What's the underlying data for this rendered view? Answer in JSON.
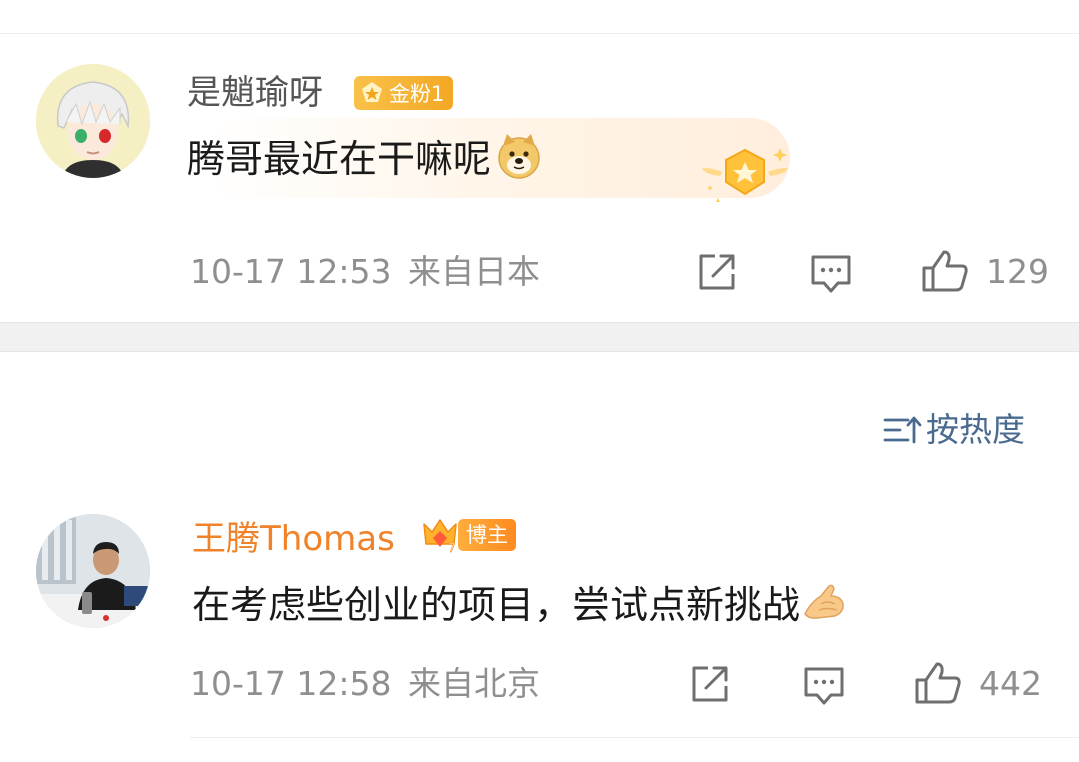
{
  "comments": [
    {
      "username": "是魈瑜呀",
      "badge": "金粉1",
      "text": "腾哥最近在干嘛呢",
      "timestamp": "10-17 12:53",
      "location": "来自日本",
      "likes": "129",
      "username_color": "#555555"
    },
    {
      "username": "王腾Thomas",
      "badge": "博主",
      "text": "在考虑些创业的项目，尝试点新挑战",
      "timestamp": "10-17 12:58",
      "location": "来自北京",
      "likes": "442",
      "username_color": "#f0822a"
    }
  ],
  "sort": {
    "label": "按热度"
  },
  "colors": {
    "accent_orange": "#f0822a",
    "badge_gold": "#f7b52c",
    "link_blue": "#4a6b8f",
    "meta_gray": "#8f8f8f"
  },
  "icons": [
    "doge-emoji-icon",
    "fan-level-star-icon",
    "share-icon",
    "comment-icon",
    "like-icon",
    "sort-icon",
    "crown-icon",
    "pinched-hand-emoji-icon"
  ]
}
